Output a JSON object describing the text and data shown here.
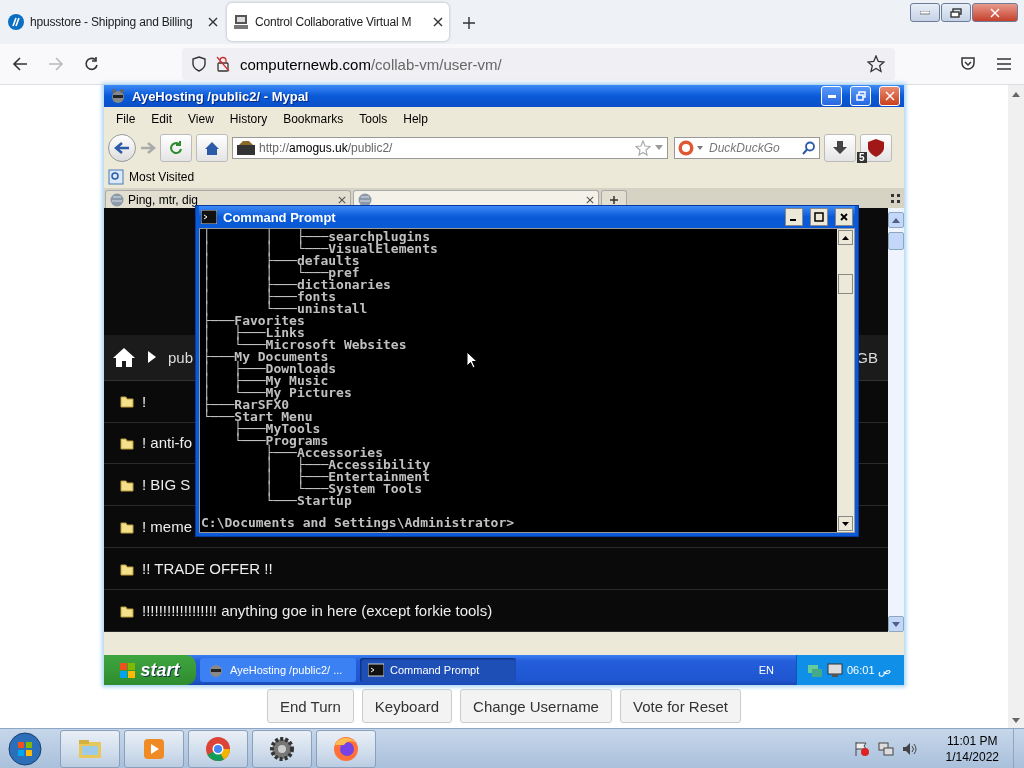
{
  "host_browser": {
    "tabs": [
      {
        "title": "hpusstore - Shipping and Billing",
        "selected": false
      },
      {
        "title": "Control Collaborative Virtual M",
        "selected": true
      }
    ],
    "url": {
      "domain": "computernewb.com",
      "path": "/collab-vm/user-vm/"
    }
  },
  "vm": {
    "browser": {
      "title": "AyeHosting /public2/ - Mypal",
      "menu": [
        "File",
        "Edit",
        "View",
        "History",
        "Bookmarks",
        "Tools",
        "Help"
      ],
      "url": {
        "scheme": "http://",
        "domain": "amogus.uk",
        "path": "/public2/"
      },
      "search": {
        "placeholder": "DuckDuckGo"
      },
      "addon_badge": "5",
      "bookmarks": [
        "Most Visited"
      ],
      "tabs": [
        {
          "title": "Ping, mtr, dig",
          "selected": false
        },
        {
          "selected": true
        }
      ],
      "page": {
        "breadcrumb": "pub",
        "size": "GB",
        "files": [
          {
            "name": "!"
          },
          {
            "name": "! anti-fo"
          },
          {
            "name": "! BIG S"
          },
          {
            "name": "! meme"
          },
          {
            "name": "!! TRADE OFFER !!"
          },
          {
            "name": "!!!!!!!!!!!!!!!!!! anything goe in here (except forkie tools)"
          }
        ]
      }
    },
    "console": {
      "title": "Command Prompt",
      "lines": [
        "│       │   ├───searchplugins",
        "│       │   └───VisualElements",
        "│       ├───defaults",
        "│       │   └───pref",
        "│       ├───dictionaries",
        "│       ├───fonts",
        "│       └───uninstall",
        "├───Favorites",
        "│   ├───Links",
        "│   └───Microsoft Websites",
        "├───My Documents",
        "│   ├───Downloads",
        "│   ├───My Music",
        "│   └───My Pictures",
        "├───RarSFX0",
        "└───Start Menu",
        "    ├───MyTools",
        "    └───Programs",
        "        ├───Accessories",
        "        │   ├───Accessibility",
        "        │   ├───Entertainment",
        "        │   └───System Tools",
        "        └───Startup"
      ],
      "prompt": "C:\\Documents and Settings\\Administrator>"
    },
    "taskbar": {
      "start": "start",
      "tasks": [
        {
          "title": "AyeHosting /public2/ ...",
          "kind": "browser",
          "selected": false
        },
        {
          "title": "Command Prompt",
          "kind": "console",
          "selected": true
        }
      ],
      "language": "EN",
      "clock": "06:01 ص"
    }
  },
  "vm_buttons": [
    "End Turn",
    "Keyboard",
    "Change Username",
    "Vote for Reset"
  ],
  "os_taskbar": {
    "apps": [
      {
        "kind": "explorer"
      },
      {
        "kind": "media"
      },
      {
        "kind": "chrome"
      },
      {
        "kind": "gear"
      },
      {
        "kind": "firefox"
      }
    ],
    "time": "11:01 PM",
    "date": "1/14/2022"
  }
}
